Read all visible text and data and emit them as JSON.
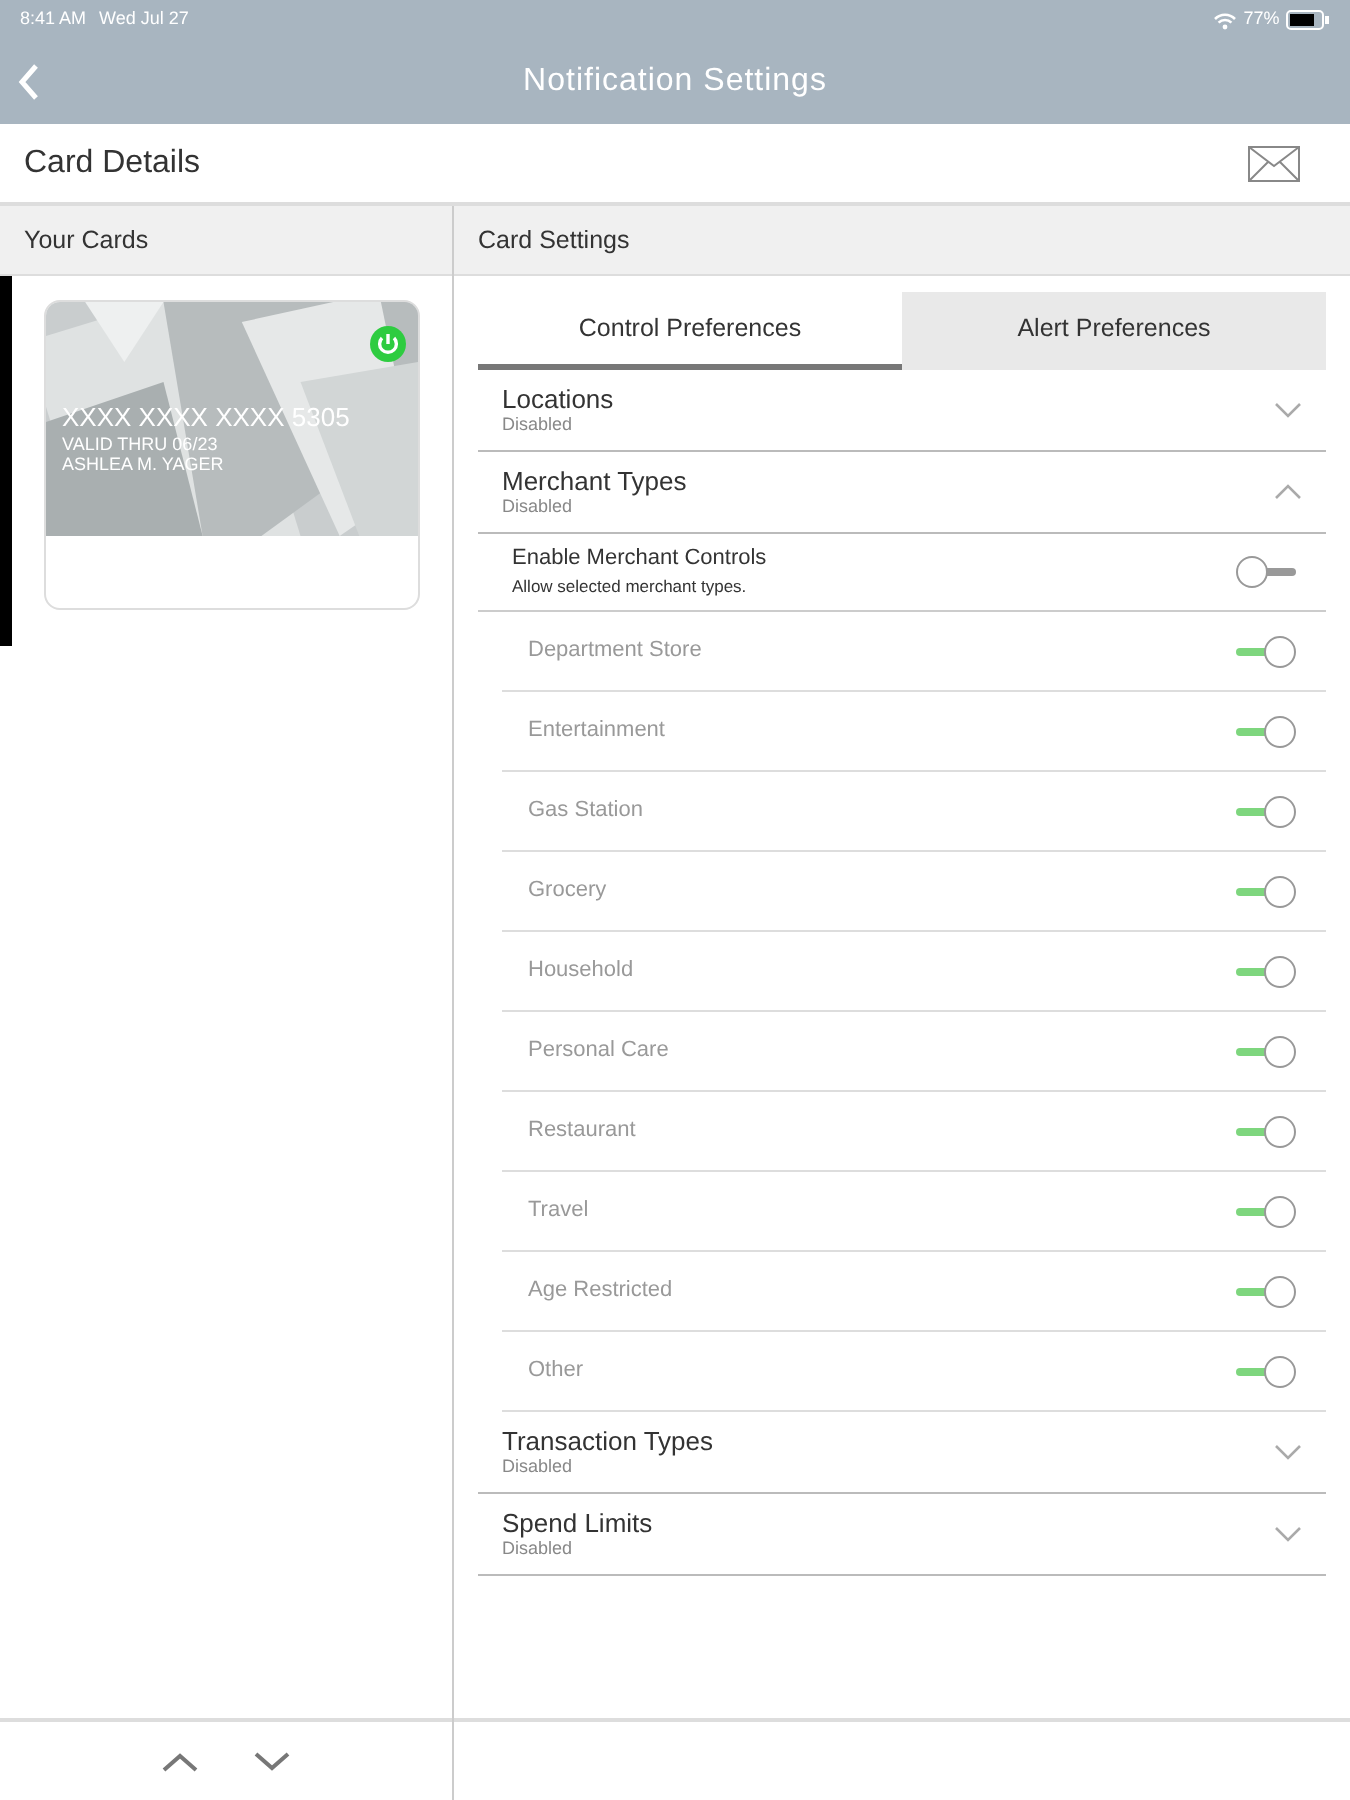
{
  "status_bar": {
    "time": "8:41 AM",
    "date": "Wed Jul 27",
    "battery": "77%"
  },
  "nav_bar": {
    "title": "Notification Settings"
  },
  "header": {
    "title": "Card Details"
  },
  "left_panel": {
    "title": "Your Cards",
    "cards": [
      {
        "selected": true,
        "active": true,
        "number": "XXXX XXXX XXXX 5305",
        "valid": "VALID THRU 06/23",
        "holder": "ASHLEA M. YAGER"
      }
    ]
  },
  "right_panel": {
    "title": "Card Settings",
    "tabs": [
      {
        "label": "Control Preferences",
        "selected": true
      },
      {
        "label": "Alert Preferences",
        "selected": false
      }
    ],
    "sections": [
      {
        "title": "Locations",
        "status": "Disabled",
        "expanded": false
      },
      {
        "title": "Merchant Types",
        "status": "Disabled",
        "expanded": true,
        "master": {
          "title": "Enable Merchant Controls",
          "subtitle": "Allow selected merchant types.",
          "on": false
        },
        "options": [
          {
            "label": "Department Store",
            "on": true
          },
          {
            "label": "Entertainment",
            "on": true
          },
          {
            "label": "Gas Station",
            "on": true
          },
          {
            "label": "Grocery",
            "on": true
          },
          {
            "label": "Household",
            "on": true
          },
          {
            "label": "Personal Care",
            "on": true
          },
          {
            "label": "Restaurant",
            "on": true
          },
          {
            "label": "Travel",
            "on": true
          },
          {
            "label": "Age Restricted",
            "on": true
          },
          {
            "label": "Other",
            "on": true
          }
        ]
      },
      {
        "title": "Transaction Types",
        "status": "Disabled",
        "expanded": false
      },
      {
        "title": "Spend Limits",
        "status": "Disabled",
        "expanded": false
      }
    ]
  }
}
